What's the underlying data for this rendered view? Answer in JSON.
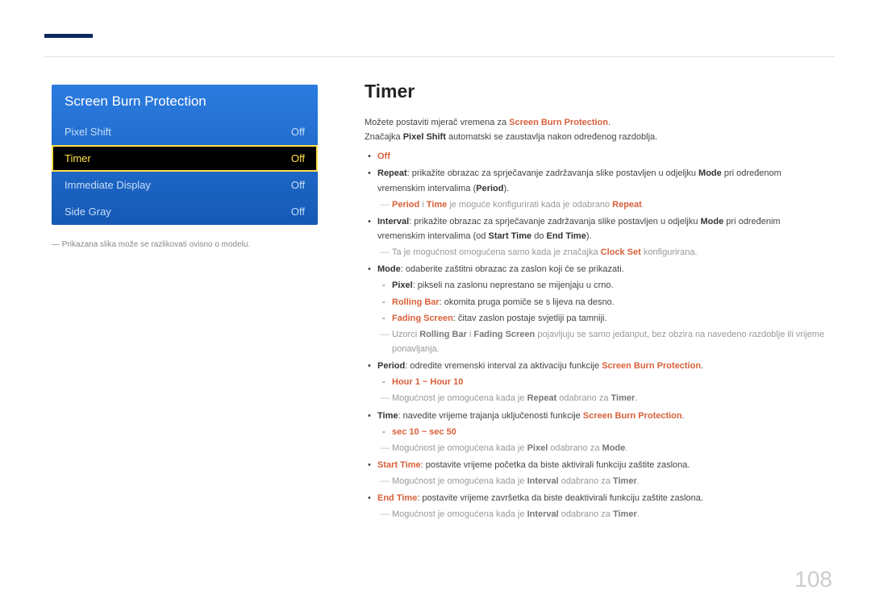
{
  "page_number": "108",
  "osd": {
    "title": "Screen Burn Protection",
    "rows": [
      {
        "label": "Pixel Shift",
        "value": "Off",
        "selected": false
      },
      {
        "label": "Timer",
        "value": "Off",
        "selected": true
      },
      {
        "label": "Immediate Display",
        "value": "Off",
        "selected": false
      },
      {
        "label": "Side Gray",
        "value": "Off",
        "selected": false
      }
    ],
    "note": "Prikazana slika može se razlikovati ovisno o modelu."
  },
  "content": {
    "title": "Timer",
    "intro1_a": "Možete postaviti mjerač vremena za ",
    "intro1_b": "Screen Burn Protection",
    "intro1_c": ".",
    "intro2_a": "Značajka ",
    "intro2_b": "Pixel Shift",
    "intro2_c": " automatski se zaustavlja nakon određenog razdoblja.",
    "off": "Off",
    "repeat_lbl": "Repeat",
    "repeat_txt": ": prikažite obrazac za sprječavanje zadržavanja slike postavljen u odjeljku ",
    "mode_word": "Mode",
    "repeat_txt2": " pri određenom vremenskim intervalima (",
    "period_word": "Period",
    "repeat_txt3": ").",
    "repeat_note_a": "Period",
    "repeat_note_b": " i ",
    "repeat_note_c": "Time",
    "repeat_note_d": " je moguće konfigurirati kada je odabrano ",
    "repeat_note_e": "Repeat",
    "repeat_note_f": ".",
    "interval_lbl": "Interval",
    "interval_txt": ": prikažite obrazac za sprječavanje zadržavanja slike postavljen u odjeljku ",
    "interval_txt2": " pri određenim vremenskim intervalima (od ",
    "starttime_word": "Start Time",
    "interval_txt3": " do ",
    "endtime_word": "End Time",
    "interval_txt4": ").",
    "interval_note_a": "Ta je mogućnost omogućena samo kada je značajka ",
    "interval_note_b": "Clock Set",
    "interval_note_c": " konfigurirana.",
    "mode_lbl": "Mode",
    "mode_txt": ": odaberite zaštitni obrazac za zaslon koji će se prikazati.",
    "pixel_lbl": "Pixel",
    "pixel_txt": ": pikseli na zaslonu neprestano se mijenjaju u crno.",
    "rolling_lbl": "Rolling Bar",
    "rolling_txt": ": okomita pruga pomiče se s lijeva na desno.",
    "fading_lbl": "Fading Screen",
    "fading_txt": ": čitav zaslon postaje svjetliji pa tamniji.",
    "mode_note_a": "Uzorci ",
    "mode_note_b": "Rolling Bar",
    "mode_note_c": " i ",
    "mode_note_d": "Fading Screen",
    "mode_note_e": " pojavljuju se samo jedanput, bez obzira na navedeno razdoblje ili vrijeme ponavljanja.",
    "period_lbl": "Period",
    "period_txt": ": odredite vremenski interval za aktivaciju funkcije ",
    "sbp": "Screen Burn Protection",
    "period_range": "Hour 1 ~ Hour 10",
    "period_note_a": "Mogućnost je omogućena kada je ",
    "period_note_b": "Repeat",
    "period_note_c": " odabrano za ",
    "period_note_d": "Timer",
    "time_lbl": "Time",
    "time_txt": ": navedite vrijeme trajanja uključenosti funkcije ",
    "time_range": "sec 10 ~ sec 50",
    "time_note_a": "Mogućnost je omogućena kada je ",
    "time_note_b": "Pixel",
    "time_note_c": " odabrano za ",
    "time_note_d": "Mode",
    "start_lbl": "Start Time",
    "start_txt": ": postavite vrijeme početka da biste aktivirali funkciju zaštite zaslona.",
    "start_note_a": "Mogućnost je omogućena kada je ",
    "start_note_b": "Interval",
    "start_note_c": " odabrano za ",
    "start_note_d": "Timer",
    "end_lbl": "End Time",
    "end_txt": ": postavite vrijeme završetka da biste deaktivirali funkciju zaštite zaslona.",
    "end_note_a": "Mogućnost je omogućena kada je ",
    "end_note_b": "Interval",
    "end_note_c": " odabrano za ",
    "end_note_d": "Timer",
    "dot": "."
  }
}
